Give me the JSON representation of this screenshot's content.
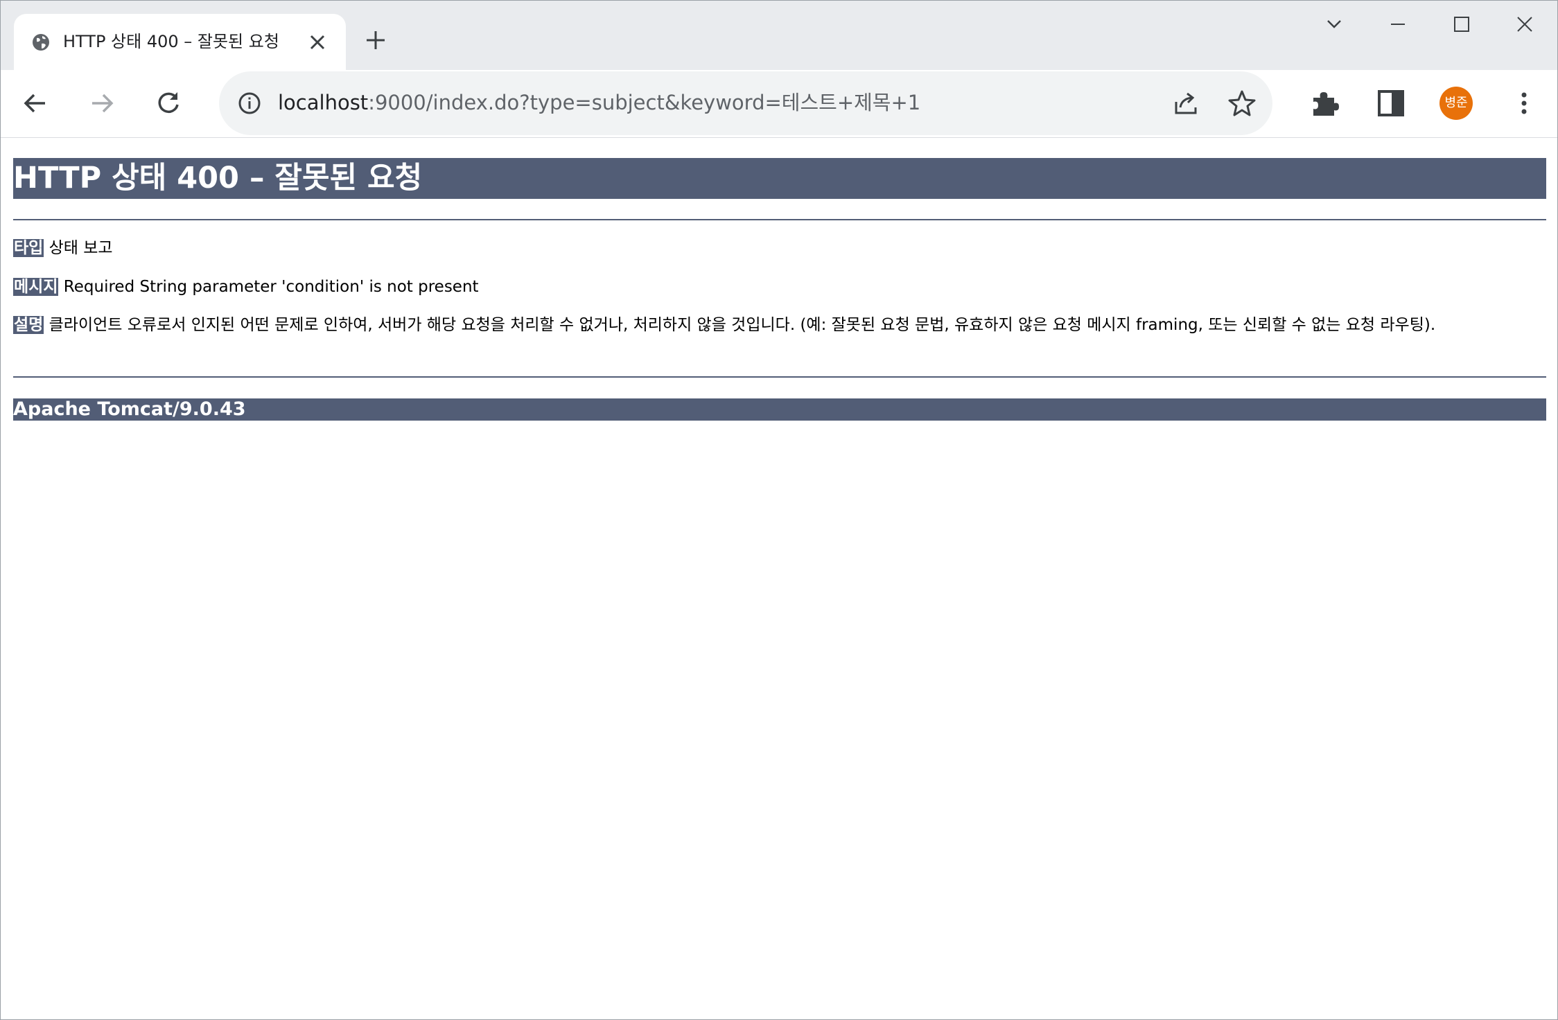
{
  "browser": {
    "tab": {
      "title": "HTTP 상태 400 – 잘못된 요청",
      "favicon": "globe-icon",
      "close_icon": "close-icon"
    },
    "new_tab_icon": "plus-icon",
    "window_controls": [
      "chevron-down-icon",
      "minimize-icon",
      "maximize-icon",
      "close-icon"
    ],
    "toolbar": {
      "back_icon": "arrow-left-icon",
      "forward_icon": "arrow-right-icon",
      "reload_icon": "reload-icon",
      "site_info_icon": "info-icon",
      "url_host": "localhost",
      "url_rest": ":9000/index.do?type=subject&keyword=테스트+제목+1",
      "share_icon": "share-icon",
      "bookmark_icon": "star-icon",
      "extensions_icon": "puzzle-icon",
      "side_panel_icon": "side-panel-icon",
      "profile_label": "병준",
      "menu_icon": "kebab-menu-icon"
    },
    "colors": {
      "tabstrip": "#e9ebee",
      "omnibox": "#f1f3f4",
      "avatar": "#e8710a"
    }
  },
  "page": {
    "heading": "HTTP 상태 400 – 잘못된 요청",
    "type_label": "타입",
    "type_value": "상태 보고",
    "message_label": "메시지",
    "message_value": "Required String parameter 'condition' is not present",
    "description_label": "설명",
    "description_value": "클라이언트 오류로서 인지된 어떤 문제로 인하여, 서버가 해당 요청을 처리할 수 없거나, 처리하지 않을 것입니다. (예: 잘못된 요청 문법, 유효하지 않은 요청 메시지 framing, 또는 신뢰할 수 없는 요청 라우팅).",
    "footer": "Apache Tomcat/9.0.43",
    "colors": {
      "accent": "#525d76"
    }
  }
}
